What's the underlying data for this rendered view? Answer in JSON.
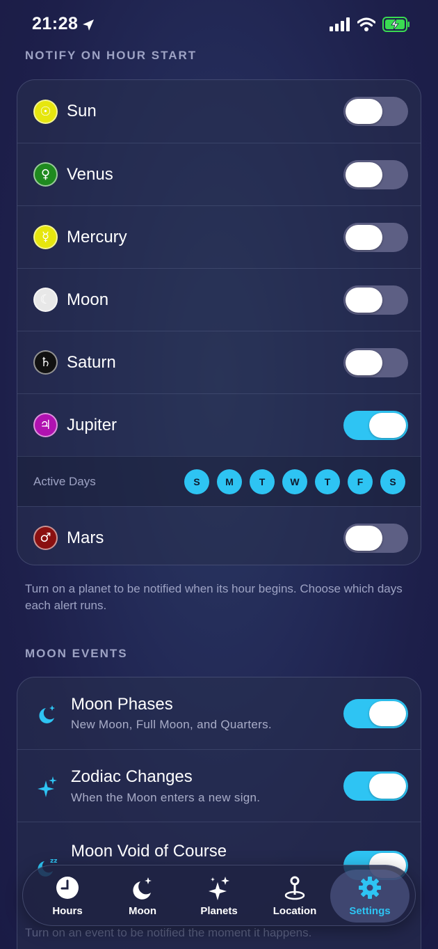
{
  "status_bar": {
    "time": "21:28"
  },
  "notify_section": {
    "title": "NOTIFY ON HOUR START",
    "planets": [
      {
        "name": "Sun",
        "symbol": "☉",
        "color": "#e6e60f",
        "on": false
      },
      {
        "name": "Venus",
        "symbol": "♀",
        "color": "#1f8a1f",
        "on": false
      },
      {
        "name": "Mercury",
        "symbol": "☿",
        "color": "#e6e60f",
        "on": false
      },
      {
        "name": "Moon",
        "symbol": "☾",
        "color": "#e8e8e8",
        "on": false
      },
      {
        "name": "Saturn",
        "symbol": "♄",
        "color": "#111111",
        "on": false
      },
      {
        "name": "Jupiter",
        "symbol": "♃",
        "color": "#b012b0",
        "on": true
      },
      {
        "name": "Mars",
        "symbol": "♂",
        "color": "#8a1010",
        "on": false
      }
    ],
    "active_days_label": "Active Days",
    "days": [
      "S",
      "M",
      "T",
      "W",
      "T",
      "F",
      "S"
    ],
    "footnote": "Turn on a planet to be notified when its hour begins. Choose which days each alert runs."
  },
  "moon_section": {
    "title": "MOON EVENTS",
    "events": [
      {
        "title": "Moon Phases",
        "subtitle": "New Moon, Full Moon, and Quarters.",
        "icon": "moon-stars-icon",
        "on": true
      },
      {
        "title": "Zodiac Changes",
        "subtitle": "When the Moon enters a new sign.",
        "icon": "sparkles-icon",
        "on": true
      },
      {
        "title": "Moon Void of Course",
        "subtitle": "",
        "icon": "moon-zzz-icon",
        "on": true
      }
    ],
    "footnote": "Turn on an event to be notified the moment it happens."
  },
  "tabbar": {
    "tabs": [
      {
        "label": "Hours",
        "icon": "clock-icon"
      },
      {
        "label": "Moon",
        "icon": "moon-stars-icon"
      },
      {
        "label": "Planets",
        "icon": "sparkles-icon"
      },
      {
        "label": "Location",
        "icon": "map-pin-icon"
      },
      {
        "label": "Settings",
        "icon": "gear-icon",
        "active": true
      }
    ]
  },
  "colors": {
    "accent": "#2ec4f3",
    "toggle_off": "#5d5f84",
    "background": "#232a57"
  }
}
